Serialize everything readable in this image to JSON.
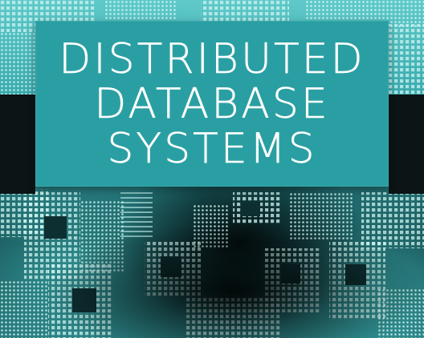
{
  "cover": {
    "title_lines": [
      "DISTRIBUTED",
      "DATABASE",
      "SYSTEMS"
    ]
  },
  "colors": {
    "title_box": "#2a9fa3",
    "title_text": "#ffffff",
    "side_bands": "#0c1416",
    "pattern_light": "#bff0ee",
    "pattern_dark": "#0f3b3e"
  },
  "icons": [
    "halftone-grid-pattern"
  ]
}
